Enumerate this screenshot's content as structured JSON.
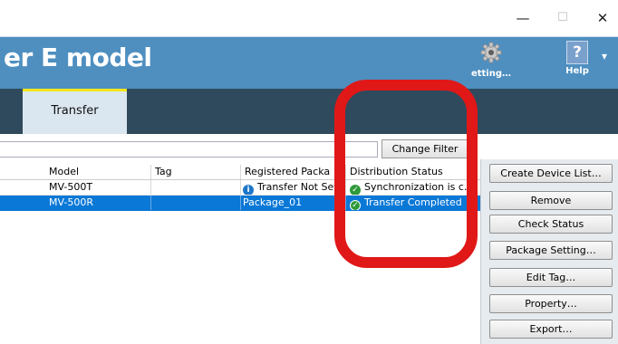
{
  "window": {
    "minimize": "—",
    "maximize": "☐",
    "close": "✕"
  },
  "app": {
    "title": "er E model"
  },
  "header": {
    "setting": {
      "label": "etting…",
      "icon": "gear-icon"
    },
    "help": {
      "label": "Help",
      "icon": "help-icon",
      "glyph": "?"
    },
    "dropdown": "▾"
  },
  "tabs": [
    {
      "label": "Transfer",
      "active": true
    }
  ],
  "filter": {
    "value": "",
    "button": "Change Filter"
  },
  "table": {
    "columns": [
      "Model",
      "Tag",
      "Registered Package",
      "Distribution Status"
    ],
    "rows": [
      {
        "model": "MV-500T",
        "tag": "",
        "package": "Transfer Not Set",
        "package_icon": "info-icon",
        "status": "Synchronization is c…",
        "status_icon": "check-icon",
        "selected": false
      },
      {
        "model": "MV-500R",
        "tag": "",
        "package": "Package_01",
        "package_icon": "",
        "status": "Transfer Completed",
        "status_icon": "check-icon",
        "selected": true
      }
    ]
  },
  "side_buttons": [
    "Create Device List…",
    "Remove",
    "Check Status",
    "Package Setting…",
    "Edit Tag…",
    "Property…",
    "Export…"
  ],
  "colors": {
    "banner": "#4e8fc0",
    "tabbar": "#2f4a5c",
    "selection": "#0a78d7",
    "annotation": "#e01818",
    "tab_accent": "#f4e51a"
  }
}
